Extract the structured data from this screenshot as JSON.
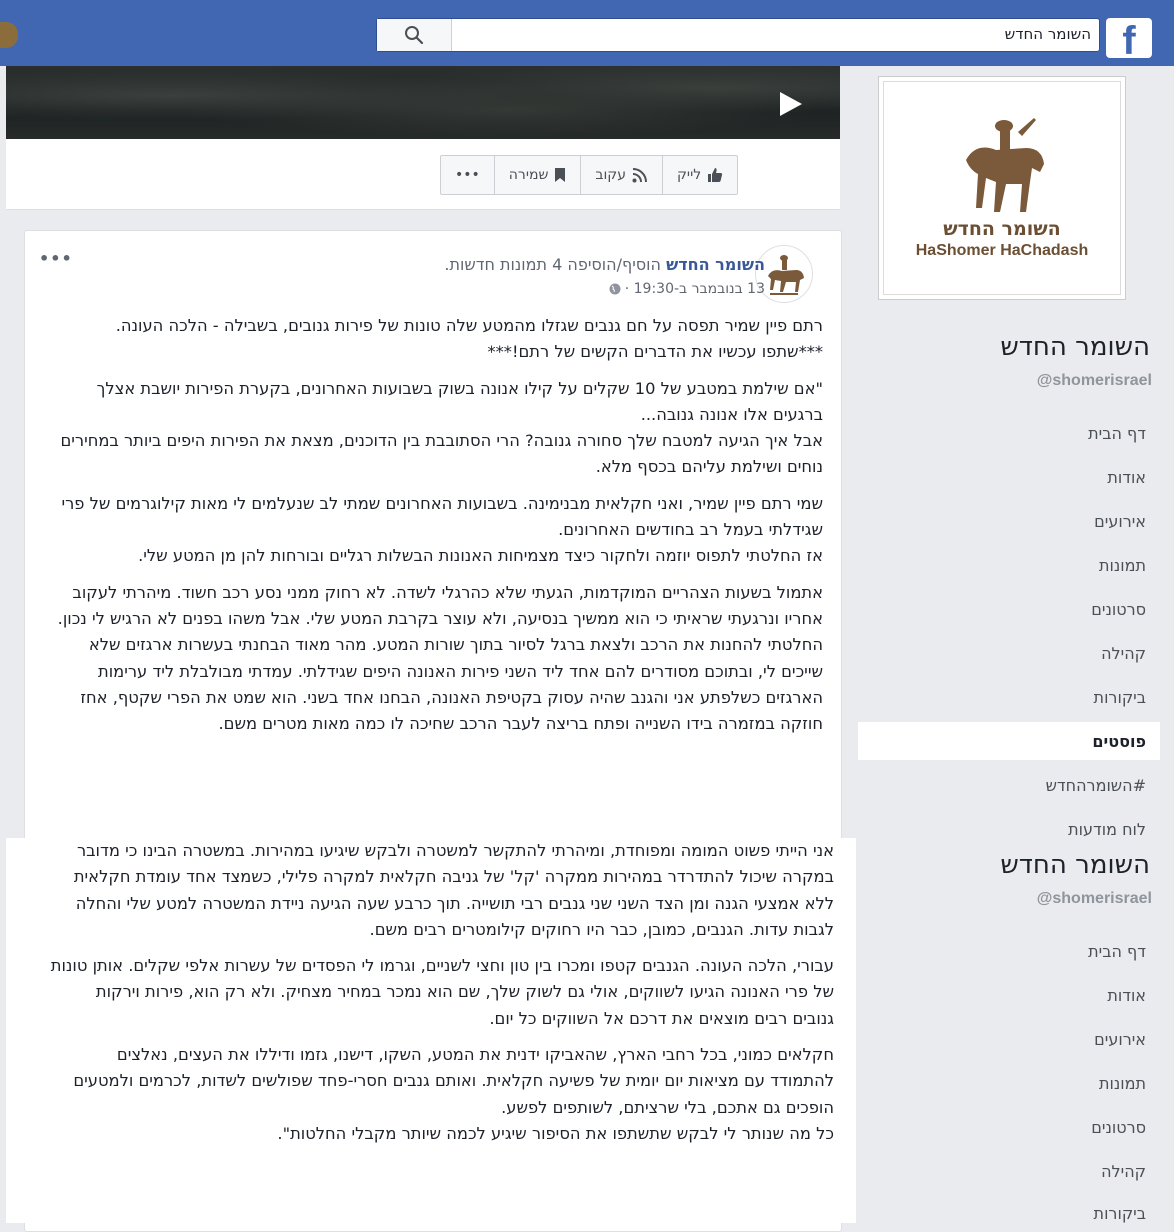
{
  "topbar": {
    "search_value": "השומר החדש",
    "brand_color": "#4267b2"
  },
  "cover": {
    "play_icon": "play-icon"
  },
  "actions": {
    "like_label": "לייק",
    "follow_label": "עקוב",
    "save_label": "שמירה",
    "more_label": "•••"
  },
  "sidebar": {
    "logo_he": "השומר החדש",
    "logo_en": "HaShomer HaChadash",
    "page_name": "השומר החדש",
    "handle": "@shomerisrael",
    "nav": [
      "דף הבית",
      "אודות",
      "אירועים",
      "תמונות",
      "סרטונים",
      "קהילה",
      "ביקורות",
      "פוסטים",
      "#השומרהחדש",
      "לוח מודעות"
    ],
    "active_nav": "פוסטים"
  },
  "sidebar2": {
    "page_name": "השומר החדש",
    "handle": "@shomerisrael",
    "nav": [
      "דף הבית",
      "אודות",
      "אירועים",
      "תמונות",
      "סרטונים",
      "קהילה",
      "ביקורות"
    ]
  },
  "post": {
    "author": "השומר החדש",
    "action": "הוסיף/הוסיפה 4 תמונות חדשות.",
    "date": "13 בנובמבר ב-19:30 ·",
    "more": "•••",
    "paragraphs": [
      [
        "רתם פיין שמיר תפסה על חם גנבים שגזלו מהמטע שלה טונות של פירות גנובים, בשבילה - הלכה העונה.",
        "***שתפו עכשיו את הדברים הקשים של רתם!***"
      ],
      [
        "\"אם שילמת במטבע של 10 שקלים על קילו אנונה בשוק בשבועות האחרונים, בקערת הפירות יושבת אצלך ברגעים אלו אנונה גנובה...",
        "אבל איך הגיעה למטבח שלך סחורה גנובה? הרי הסתובבת בין הדוכנים, מצאת את הפירות היפים ביותר במחירים נוחים ושילמת עליהם בכסף מלא."
      ],
      [
        "שמי רתם פיין שמיר, ואני חקלאית מבנימינה. בשבועות האחרונים שמתי לב שנעלמים לי מאות קילוגרמים של פרי שגידלתי בעמל רב בחודשים האחרונים.",
        "אז החלטתי לתפוס יוזמה ולחקור כיצד מצמיחות האנונות הבשלות רגליים ובורחות להן מן המטע שלי."
      ],
      [
        "אתמול בשעות הצהריים המוקדמות, הגעתי שלא כהרגלי לשדה. לא רחוק ממני נסע רכב חשוד. מיהרתי לעקוב אחריו ונרגעתי שראיתי כי הוא ממשיך בנסיעה, ולא עוצר בקרבת המטע שלי. אבל משהו בפנים לא הרגיש לי נכון. החלטתי להחנות את הרכב ולצאת ברגל לסיור בתוך שורות המטע. מהר מאוד הבחנתי בעשרות ארגזים שלא שייכים לי, ובתוכם מסודרים להם אחד ליד השני פירות האנונה היפים שגידלתי. עמדתי מבולבלת ליד ערימות הארגזים כשלפתע אני והגנב שהיה עסוק בקטיפת האנונה, הבחנו אחד בשני. הוא שמט את הפרי שקטף, אחז חוזקה במזמרה בידו השנייה ופתח בריצה לעבר הרכב שחיכה לו כמה מאות מטרים משם."
      ]
    ]
  },
  "lower": {
    "paragraphs": [
      [
        "אני הייתי פשוט המומה ומפוחדת, ומיהרתי להתקשר למשטרה ולבקש שיגיעו במהירות. במשטרה הבינו כי מדובר במקרה שיכול להתדרדר במהירות ממקרה 'קל' של גניבה חקלאית למקרה פלילי, כשמצד אחד עומדת חקלאית ללא אמצעי הגנה ומן הצד השני שני גנבים רבי תושייה. תוך כרבע שעה הגיעה ניידת המשטרה למטע שלי והחלה לגבות עדות. הגנבים, כמובן, כבר היו רחוקים קילומטרים רבים משם."
      ],
      [
        "עבורי, הלכה העונה. הגנבים קטפו ומכרו בין טון וחצי לשניים, וגרמו לי הפסדים של עשרות אלפי שקלים. אותן טונות של פרי האנונה הגיעו לשווקים, אולי גם לשוק שלך, שם הוא נמכר במחיר מצחיק. ולא רק הוא, פירות וירקות גנובים רבים מוצאים את דרכם אל השווקים כל יום."
      ],
      [
        "חקלאים כמוני, בכל רחבי הארץ, שהאביקו ידנית את המטע, השקו, דישנו, גזמו ודיללו את העצים, נאלצים להתמודד עם מציאות יום יומית של פשיעה חקלאית. ואותם גנבים חסרי-פחד שפולשים לשדות, לכרמים ולמטעים הופכים גם אתכם, בלי שרציתם, לשותפים לפשע.",
        "כל מה שנותר לי לבקש שתשתפו את הסיפור שיגיע לכמה שיותר מקבלי החלטות\"."
      ]
    ]
  }
}
